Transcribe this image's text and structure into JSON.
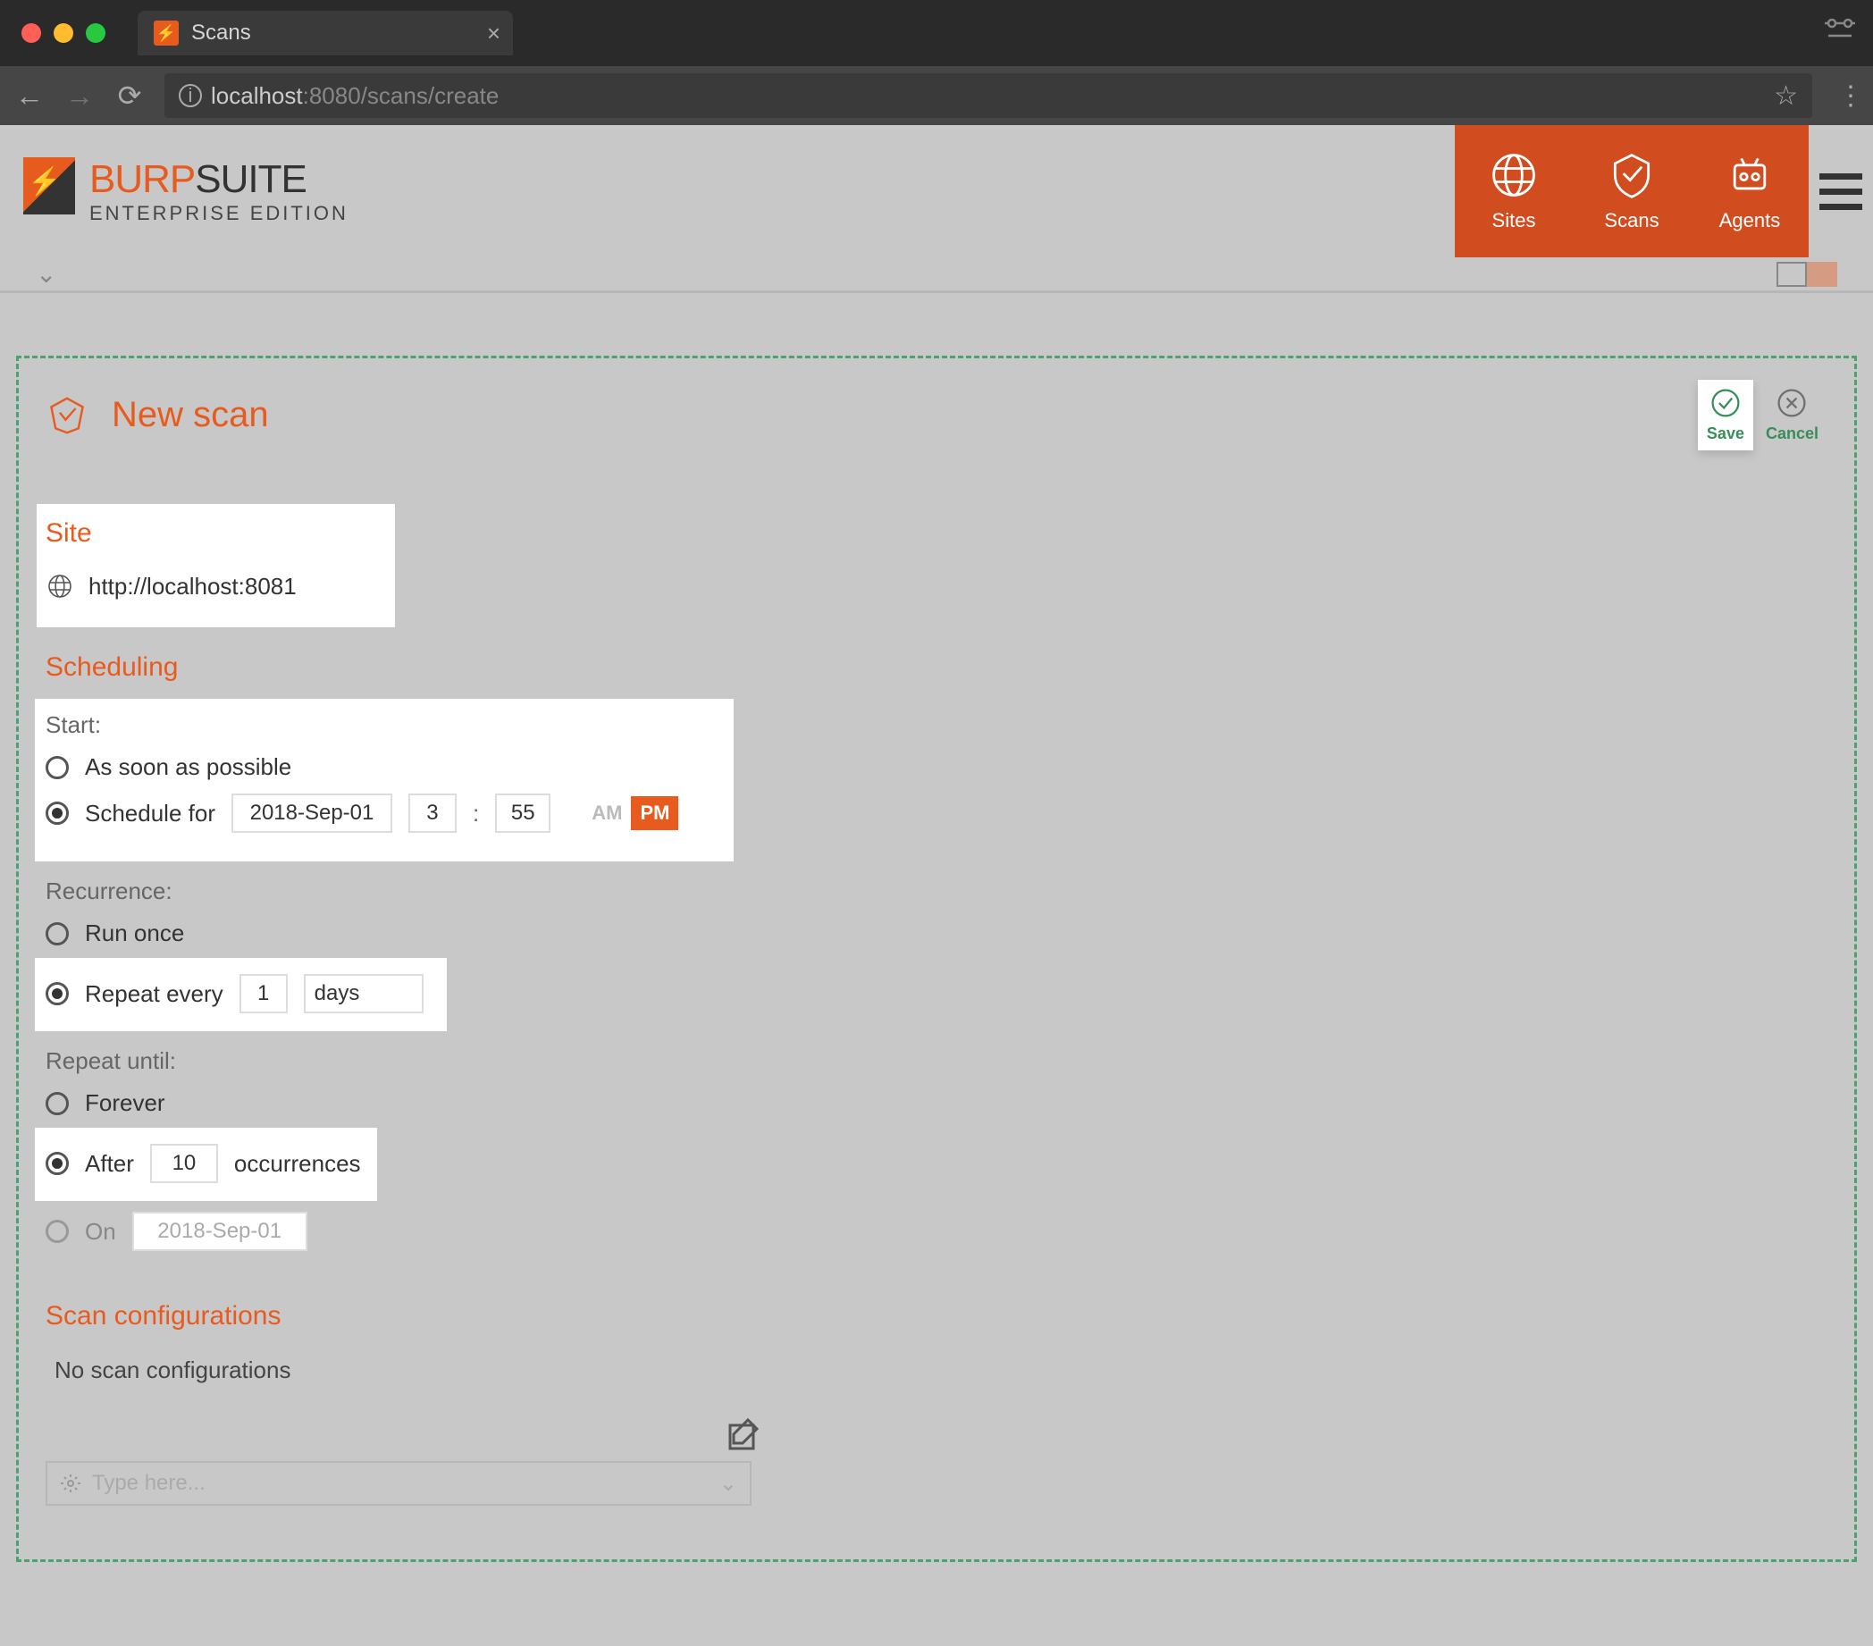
{
  "browser": {
    "tab_title": "Scans",
    "url_host": "localhost",
    "url_port": ":8080",
    "url_path": "/scans/create"
  },
  "logo": {
    "brand_left": "BURP",
    "brand_right": "SUITE",
    "tagline": "ENTERPRISE EDITION"
  },
  "top_nav": {
    "sites": "Sites",
    "scans": "Scans",
    "agents": "Agents"
  },
  "panel": {
    "title": "New scan",
    "save_label": "Save",
    "cancel_label": "Cancel"
  },
  "site": {
    "section_title": "Site",
    "url": "http://localhost:8081"
  },
  "scheduling": {
    "section_title": "Scheduling",
    "start_label": "Start:",
    "opt_asap": "As soon as possible",
    "opt_schedule_for": "Schedule for",
    "date": "2018-Sep-01",
    "hour": "3",
    "minute": "55",
    "am": "AM",
    "pm": "PM",
    "recurrence_label": "Recurrence:",
    "opt_run_once": "Run once",
    "opt_repeat_every": "Repeat every",
    "repeat_value": "1",
    "repeat_unit": "days",
    "repeat_until_label": "Repeat until:",
    "opt_forever": "Forever",
    "opt_after": "After",
    "occurrences_value": "10",
    "occurrences_label": "occurrences",
    "opt_on": "On",
    "on_date": "2018-Sep-01"
  },
  "scan_config": {
    "section_title": "Scan configurations",
    "empty_msg": "No scan configurations",
    "placeholder": "Type here..."
  }
}
